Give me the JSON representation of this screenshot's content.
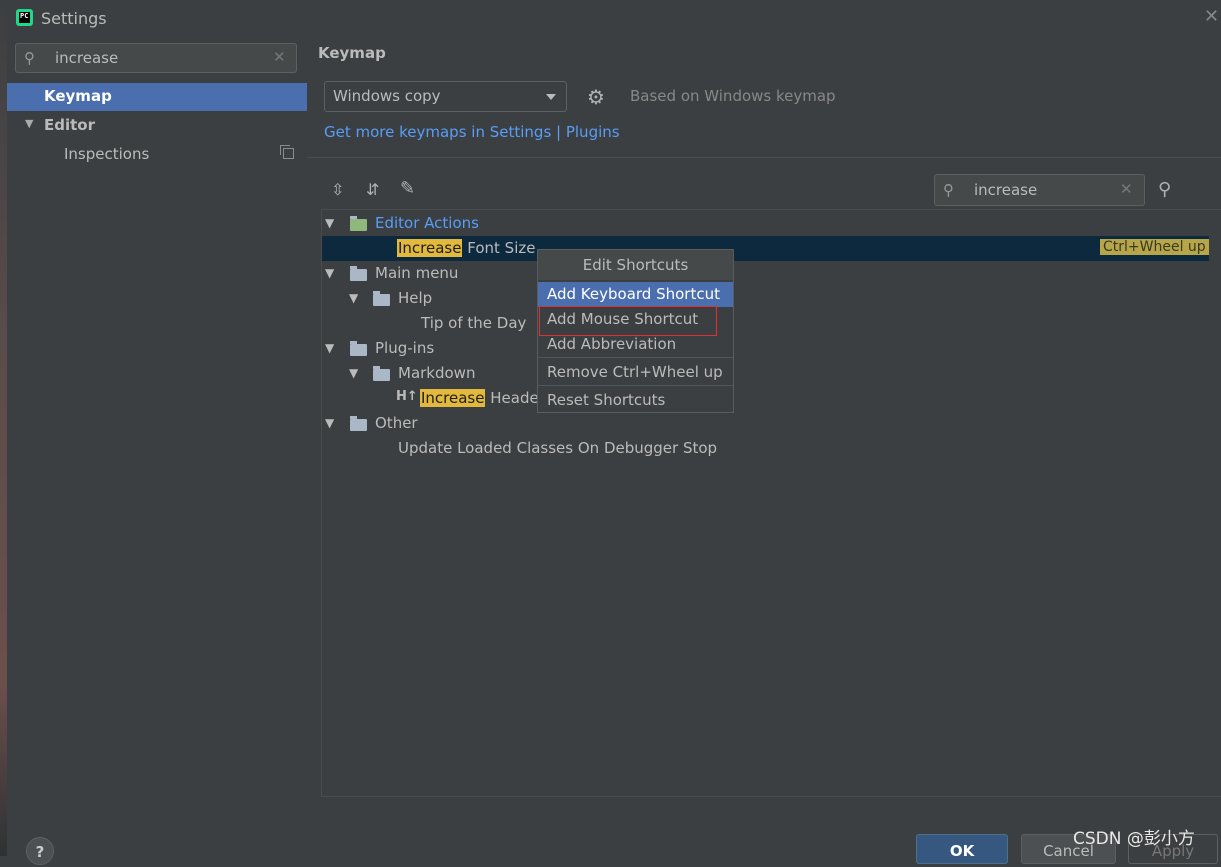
{
  "window": {
    "title": "Settings"
  },
  "sidebar": {
    "search_value": "increase",
    "items": [
      {
        "label": "Keymap"
      },
      {
        "label": "Editor"
      },
      {
        "label": "Inspections"
      }
    ]
  },
  "main": {
    "title": "Keymap",
    "keymap_selected": "Windows copy",
    "based_on": "Based on Windows keymap",
    "link": "Get more keymaps in Settings | Plugins",
    "filter_value": "increase",
    "tree": {
      "editor_actions": "Editor Actions",
      "increase_hl": "Increase",
      "font_size_rest": " Font Size",
      "shortcut": "Ctrl+Wheel up",
      "main_menu": "Main menu",
      "help": "Help",
      "tip_of_day": "Tip of the Day",
      "plugins": "Plug-ins",
      "markdown": "Markdown",
      "header_rest": " Header",
      "other": "Other",
      "update_loaded": "Update Loaded Classes On Debugger Stop"
    }
  },
  "popup": {
    "title": "Edit Shortcuts",
    "items": [
      "Add Keyboard Shortcut",
      "Add Mouse Shortcut",
      "Add Abbreviation",
      "Remove Ctrl+Wheel up",
      "Reset Shortcuts"
    ]
  },
  "footer": {
    "help": "?",
    "ok": "OK",
    "cancel": "Cancel",
    "apply": "Apply"
  },
  "watermark": "CSDN @彭小方",
  "colors": {
    "selection": "#4b6eaf",
    "highlight": "#e2b93c",
    "link": "#589df6",
    "annotation_box": "#e03030"
  }
}
